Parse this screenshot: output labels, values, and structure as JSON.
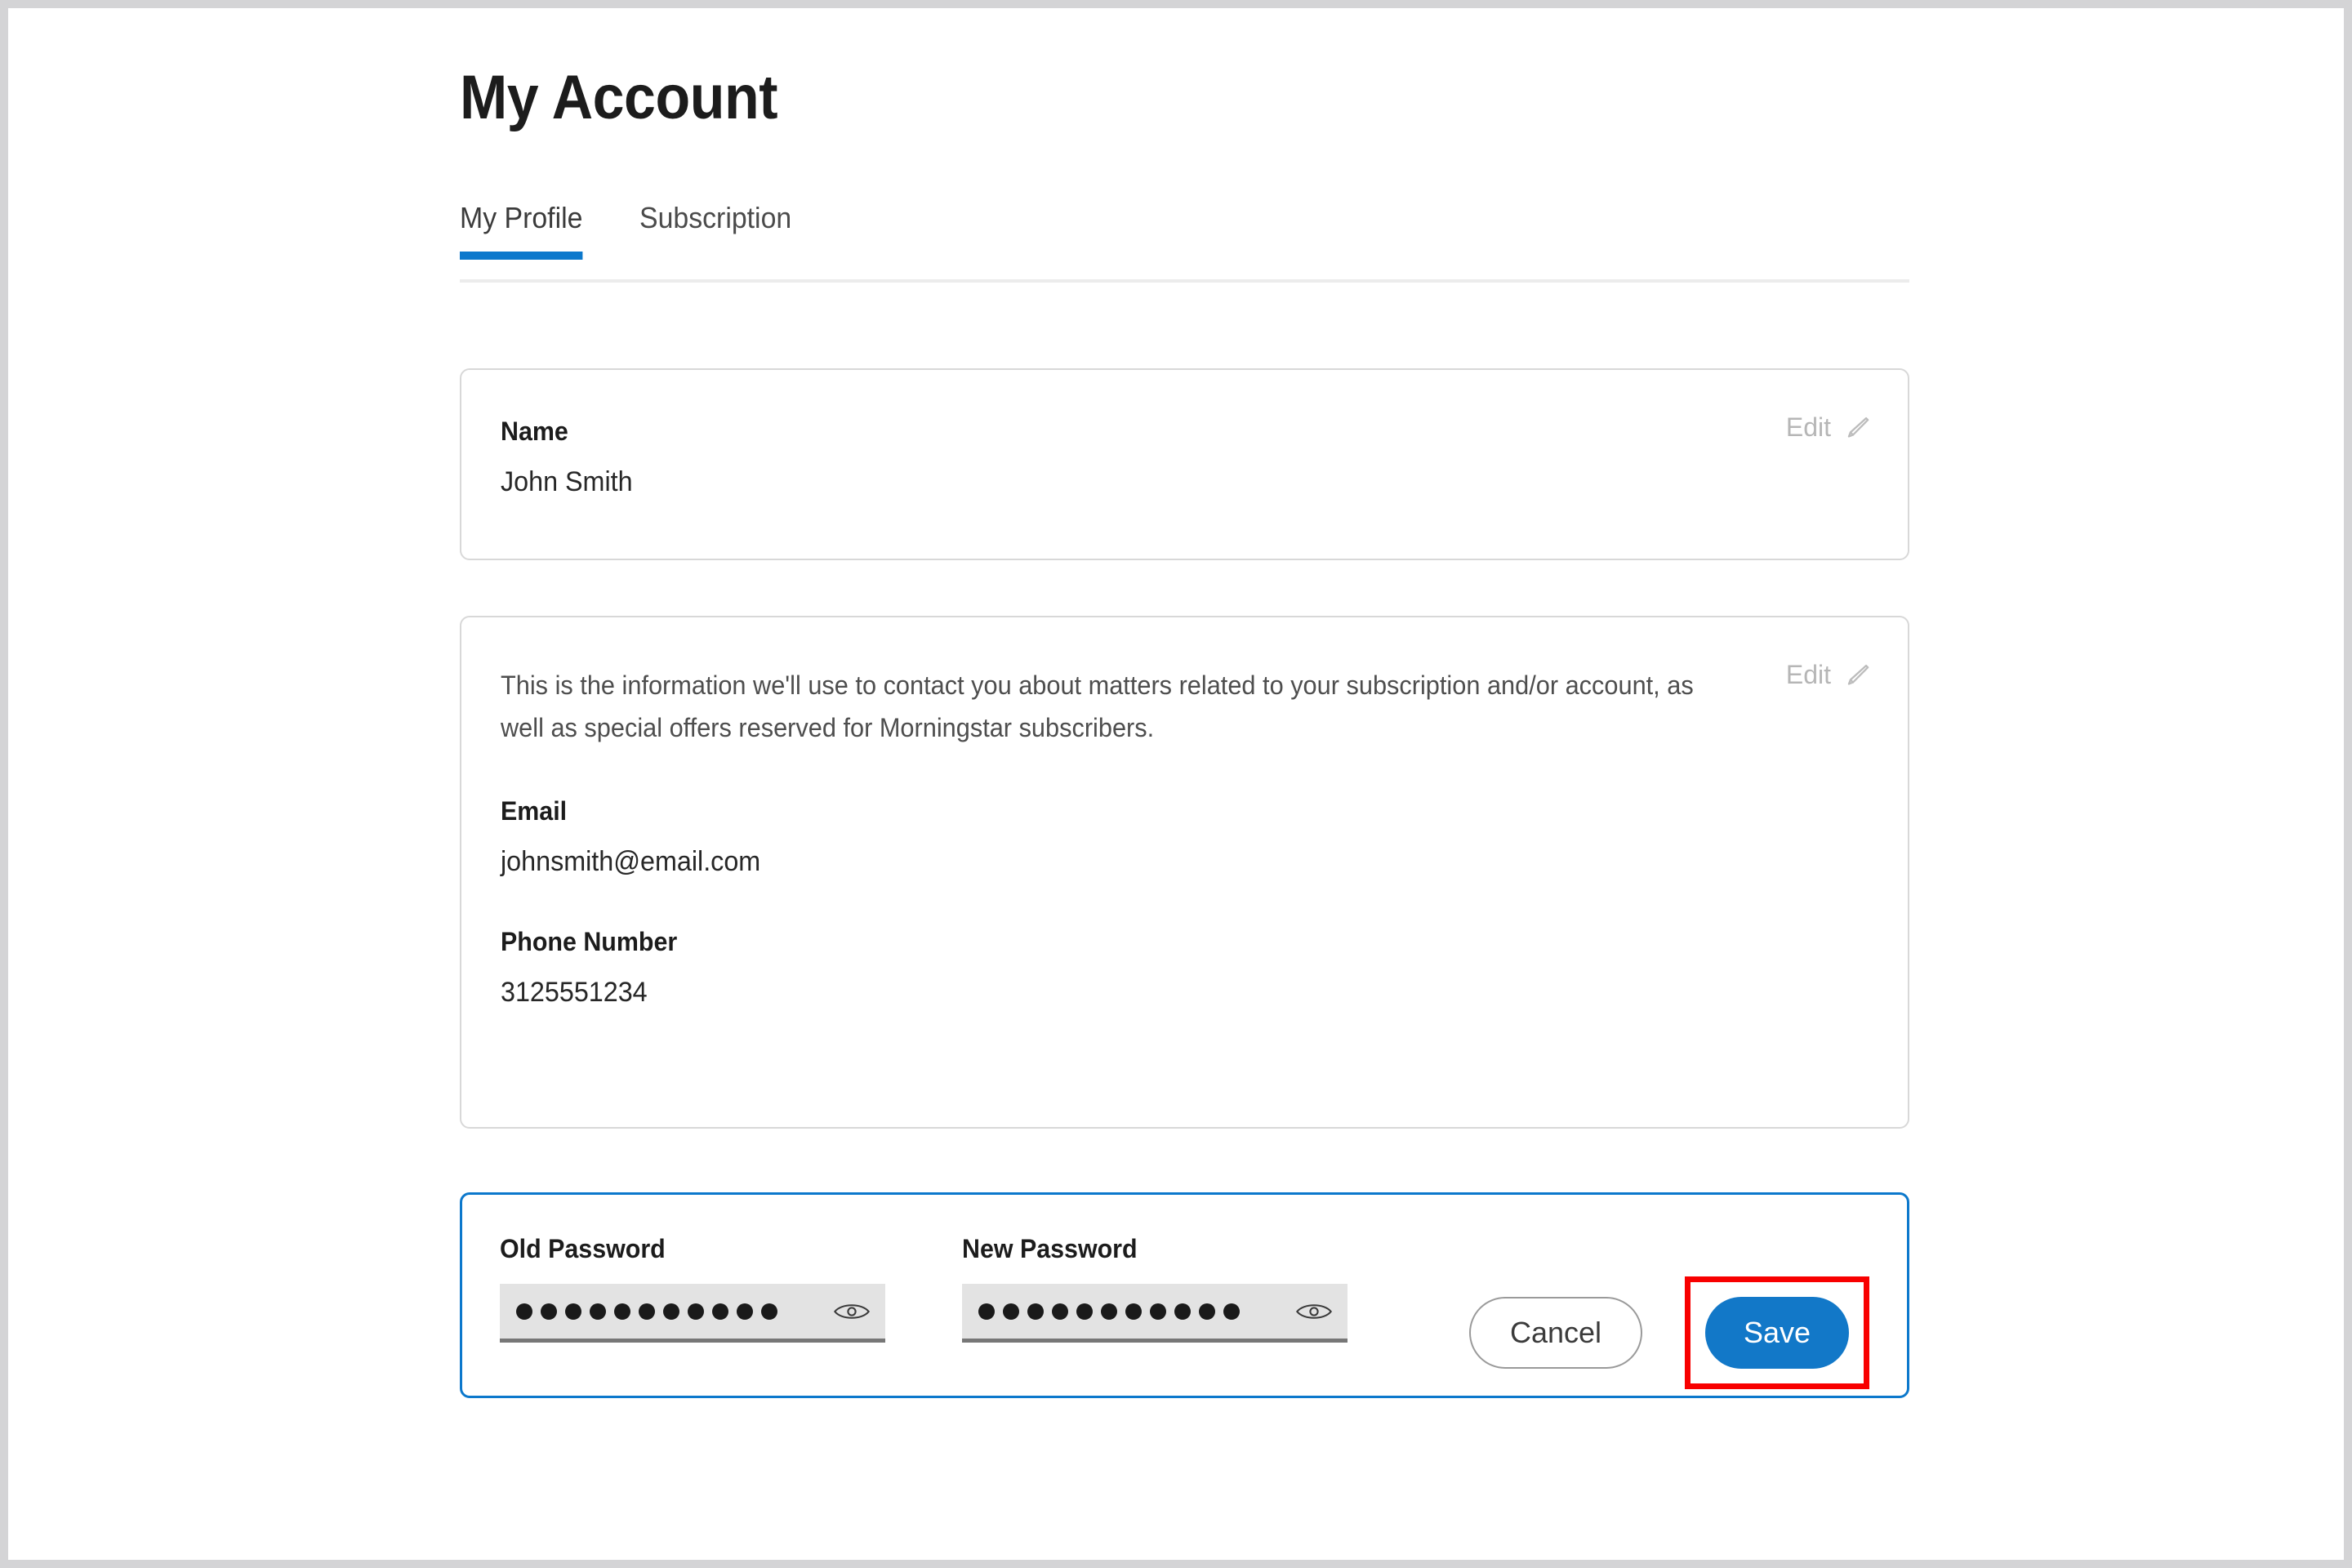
{
  "page": {
    "title": "My Account"
  },
  "tabs": [
    {
      "label": "My Profile",
      "active": true
    },
    {
      "label": "Subscription",
      "active": false
    }
  ],
  "name_card": {
    "label": "Name",
    "value": "John Smith",
    "edit_label": "Edit",
    "edit_icon": "pencil-icon"
  },
  "contact_card": {
    "description": "This is the information we'll use to contact you about matters related to your subscription and/or account, as well as special offers reserved for Morningstar subscribers.",
    "edit_label": "Edit",
    "edit_icon": "pencil-icon",
    "email_label": "Email",
    "email_value": "johnsmith@email.com",
    "phone_label": "Phone Number",
    "phone_value": "3125551234"
  },
  "password_card": {
    "old_password_label": "Old Password",
    "old_password_value": "•••••••••••",
    "old_password_dots": 11,
    "new_password_label": "New Password",
    "new_password_value": "•••••••••••",
    "new_password_dots": 11,
    "reveal_icon": "eye-icon",
    "cancel_label": "Cancel",
    "save_label": "Save"
  },
  "colors": {
    "accent_blue": "#1278c8",
    "tab_underline": "#0c78cc",
    "password_card_border": "#0c78cc",
    "highlight_red": "#f80000",
    "card_border": "#d8d8d8",
    "input_fill": "#e3e3e3",
    "muted_text": "#b6b6b6"
  }
}
